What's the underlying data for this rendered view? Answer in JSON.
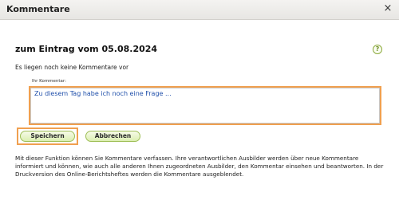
{
  "dialog": {
    "title": "Kommentare",
    "close_symbol": "×"
  },
  "content": {
    "heading": "zum Eintrag vom 05.08.2024",
    "help_symbol": "?",
    "info_text": "Es liegen noch keine Kommentare vor",
    "comment_label": "Ihr Kommentar:",
    "comment_value": "Zu diesem Tag habe ich noch eine Frage ...",
    "save_label": "Speichern",
    "cancel_label": "Abbrechen",
    "description": "Mit dieser Funktion können Sie Kommentare verfassen. Ihre verantwortlichen Ausbilder werden über neue Kommentare informiert und können, wie auch alle anderen Ihnen zugeordneten Ausbilder, den Kommentar einsehen und beantworten. In der Druckversion des Online-Berichtsheftes werden die Kommentare ausgeblendet."
  },
  "colors": {
    "highlight": "#f0a050",
    "button_border": "#9fbf57",
    "comment_text": "#1f4faa"
  },
  "icons": {
    "close": "close-icon",
    "help": "help-icon"
  }
}
